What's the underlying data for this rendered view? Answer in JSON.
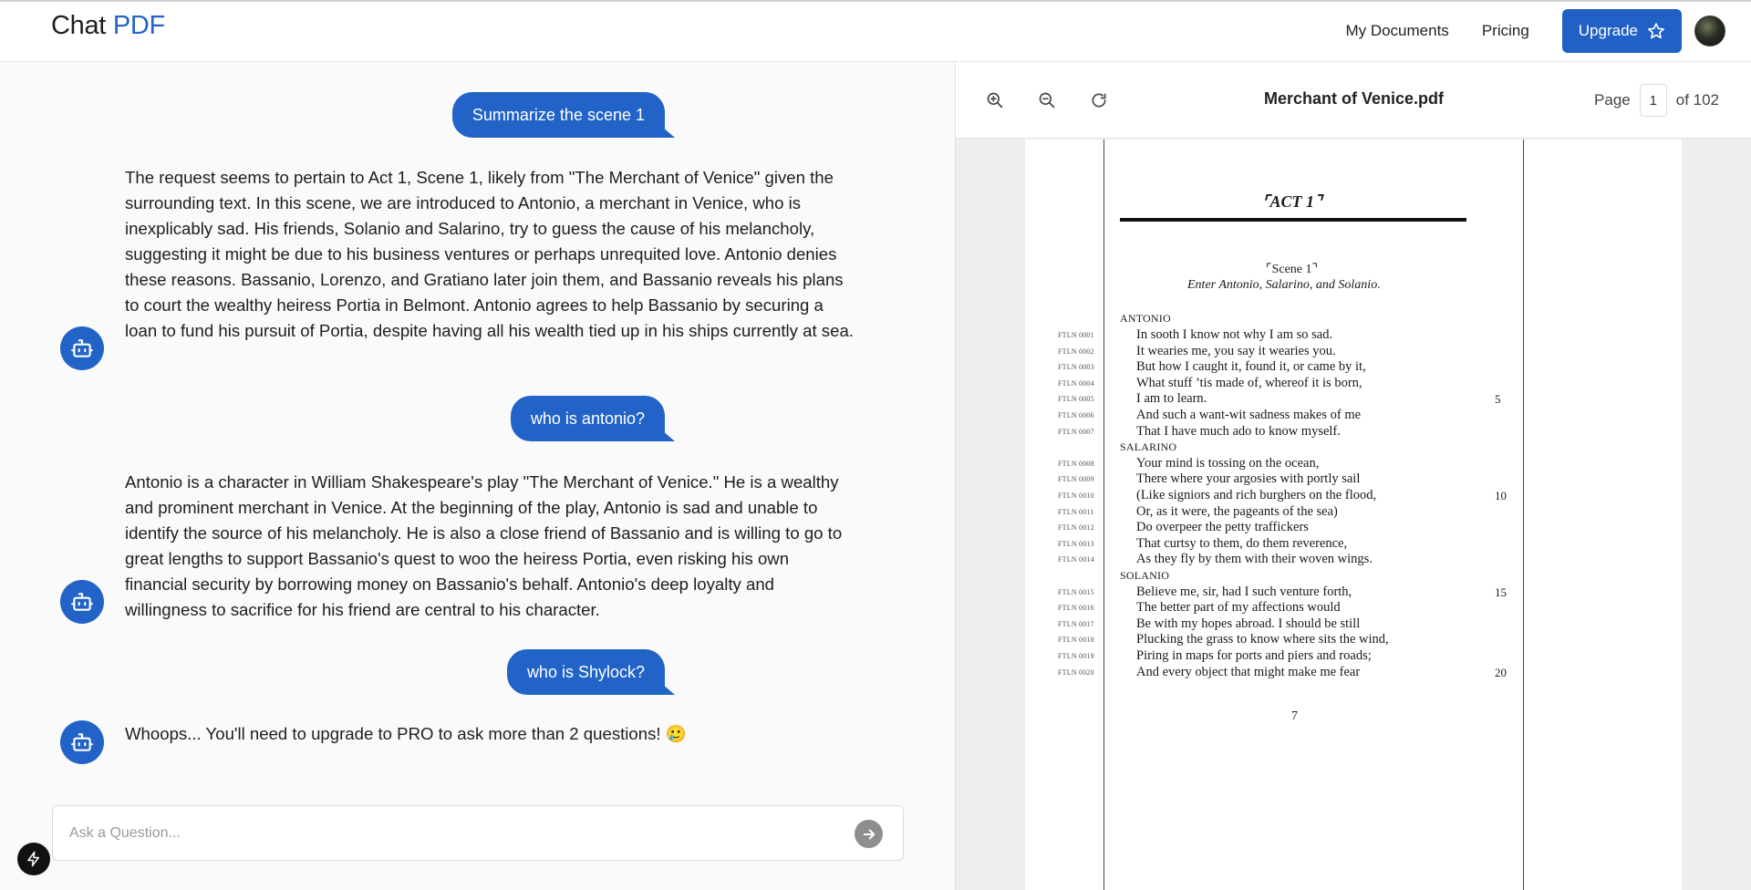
{
  "header": {
    "logo_part1": "Chat",
    "logo_part2": "PDF",
    "nav_my_documents": "My Documents",
    "nav_pricing": "Pricing",
    "upgrade_label": "Upgrade"
  },
  "chat": {
    "messages": [
      {
        "role": "user",
        "text": "Summarize the scene 1"
      },
      {
        "role": "bot",
        "text": "The request seems to pertain to Act 1, Scene 1, likely from \"The Merchant of Venice\" given the surrounding text. In this scene, we are introduced to Antonio, a merchant in Venice, who is inexplicably sad. His friends, Solanio and Salarino, try to guess the cause of his melancholy, suggesting it might be due to his business ventures or perhaps unrequited love. Antonio denies these reasons. Bassanio, Lorenzo, and Gratiano later join them, and Bassanio reveals his plans to court the wealthy heiress Portia in Belmont. Antonio agrees to help Bassanio by securing a loan to fund his pursuit of Portia, despite having all his wealth tied up in his ships currently at sea."
      },
      {
        "role": "user",
        "text": "who is antonio?"
      },
      {
        "role": "bot",
        "text": "Antonio is a character in William Shakespeare's play \"The Merchant of Venice.\" He is a wealthy and prominent merchant in Venice. At the beginning of the play, Antonio is sad and unable to identify the source of his melancholy. He is also a close friend of Bassanio and is willing to go to great lengths to support Bassanio's quest to woo the heiress Portia, even risking his own financial security by borrowing money on Bassanio's behalf. Antonio's deep loyalty and willingness to sacrifice for his friend are central to his character."
      },
      {
        "role": "user",
        "text": "who is Shylock?"
      },
      {
        "role": "bot",
        "text": "Whoops... You'll need to upgrade to PRO to ask more than 2 questions! 🥲"
      }
    ],
    "input_placeholder": "Ask a Question..."
  },
  "pdf": {
    "title": "Merchant of Venice.pdf",
    "page_label": "Page",
    "page_current": "1",
    "page_total_label": "of 102",
    "content": {
      "act": "⌜ACT 1⌝",
      "scene": "⌜Scene 1⌝",
      "stage_direction": "Enter Antonio, Salarino, and Solanio.",
      "speakers": [
        "ANTONIO",
        "SALARINO",
        "SOLANIO"
      ],
      "lines": [
        {
          "ftln": "FTLN 0001",
          "text": "In sooth I know not why I am so sad.",
          "num": ""
        },
        {
          "ftln": "FTLN 0002",
          "text": "It wearies me, you say it wearies you.",
          "num": ""
        },
        {
          "ftln": "FTLN 0003",
          "text": "But how I caught it, found it, or came by it,",
          "num": ""
        },
        {
          "ftln": "FTLN 0004",
          "text": "What stuff ’tis made of, whereof it is born,",
          "num": ""
        },
        {
          "ftln": "FTLN 0005",
          "text": "I am to learn.",
          "num": "5"
        },
        {
          "ftln": "FTLN 0006",
          "text": "And such a want-wit sadness makes of me",
          "num": ""
        },
        {
          "ftln": "FTLN 0007",
          "text": "That I have much ado to know myself.",
          "num": ""
        },
        {
          "ftln": "FTLN 0008",
          "text": "Your mind is tossing on the ocean,",
          "num": ""
        },
        {
          "ftln": "FTLN 0009",
          "text": "There where your argosies with portly sail",
          "num": ""
        },
        {
          "ftln": "FTLN 0010",
          "text": "(Like signiors and rich burghers on the flood,",
          "num": "10"
        },
        {
          "ftln": "FTLN 0011",
          "text": "Or, as it were, the pageants of the sea)",
          "num": ""
        },
        {
          "ftln": "FTLN 0012",
          "text": "Do overpeer the petty traffickers",
          "num": ""
        },
        {
          "ftln": "FTLN 0013",
          "text": "That curtsy to them, do them reverence,",
          "num": ""
        },
        {
          "ftln": "FTLN 0014",
          "text": "As they fly by them with their woven wings.",
          "num": ""
        },
        {
          "ftln": "FTLN 0015",
          "text": "Believe me, sir, had I such venture forth,",
          "num": "15"
        },
        {
          "ftln": "FTLN 0016",
          "text": "The better part of my affections would",
          "num": ""
        },
        {
          "ftln": "FTLN 0017",
          "text": "Be with my hopes abroad. I should be still",
          "num": ""
        },
        {
          "ftln": "FTLN 0018",
          "text": "Plucking the grass to know where sits the wind,",
          "num": ""
        },
        {
          "ftln": "FTLN 0019",
          "text": "Piring in maps for ports and piers and roads;",
          "num": ""
        },
        {
          "ftln": "FTLN 0020",
          "text": "And every object that might make me fear",
          "num": "20"
        }
      ],
      "page_number": "7"
    }
  },
  "colors": {
    "accent": "#2263c8",
    "logo_blue": "#2563c9"
  }
}
